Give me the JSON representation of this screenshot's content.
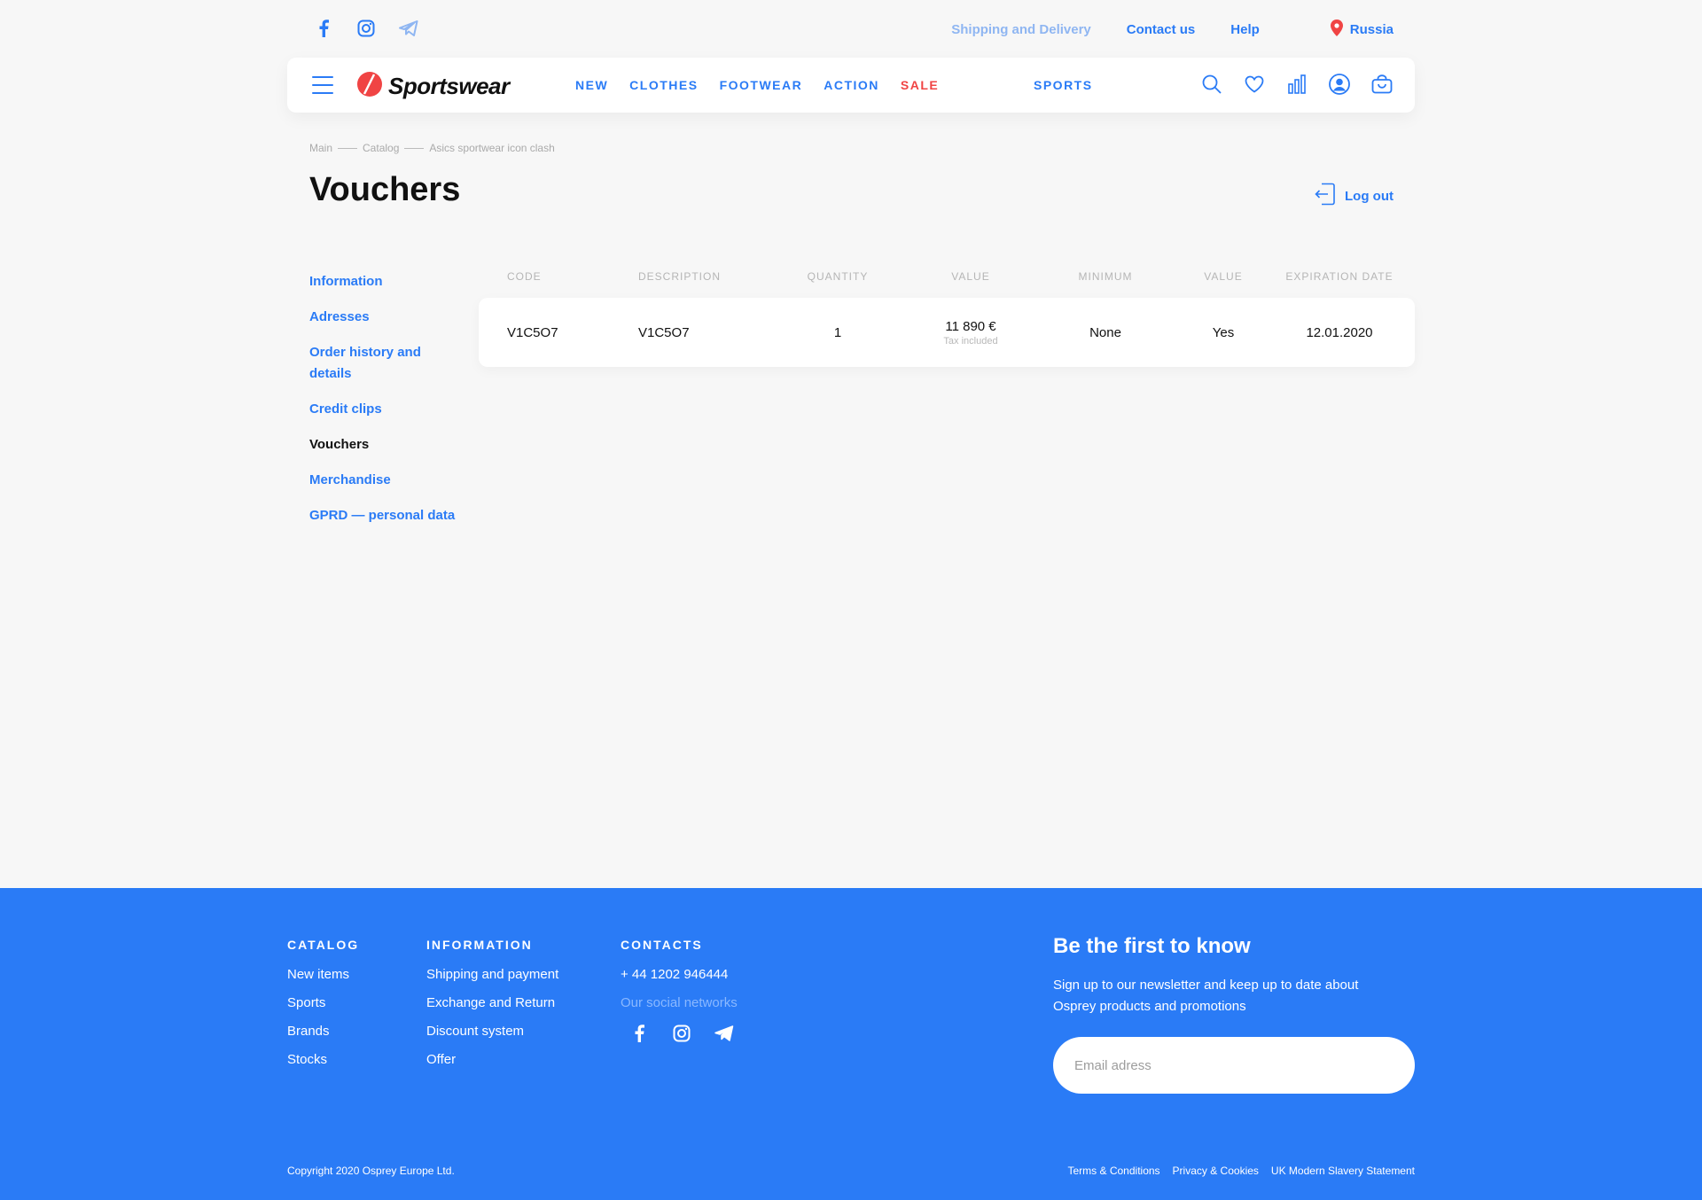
{
  "topbar": {
    "social_icons": [
      "facebook-icon",
      "instagram-icon",
      "telegram-icon"
    ],
    "links": {
      "shipping": "Shipping and Delivery",
      "contact": "Contact us",
      "help": "Help"
    },
    "region": "Russia"
  },
  "header": {
    "logo_text": "Sportswear",
    "nav": [
      "NEW",
      "CLOTHES",
      "FOOTWEAR",
      "ACTION",
      "SALE"
    ],
    "sports": "SPORTS",
    "icons": [
      "search-icon",
      "heart-icon",
      "compare-icon",
      "user-icon",
      "bag-icon"
    ]
  },
  "breadcrumb": [
    "Main",
    "Catalog",
    "Asics sportwear icon clash"
  ],
  "page": {
    "title": "Vouchers",
    "logout": "Log out"
  },
  "sidebar": {
    "items": [
      {
        "label": "Information",
        "active": false
      },
      {
        "label": "Adresses",
        "active": false
      },
      {
        "label": "Order history and details",
        "active": false
      },
      {
        "label": "Credit clips",
        "active": false
      },
      {
        "label": "Vouchers",
        "active": true
      },
      {
        "label": "Merchandise",
        "active": false
      },
      {
        "label": "GPRD — personal data",
        "active": false
      }
    ]
  },
  "table": {
    "headers": [
      "CODE",
      "DESCRIPTION",
      "QUANTITY",
      "VALUE",
      "MINIMUM",
      "VALUE",
      "EXPIRATION DATE"
    ],
    "rows": [
      {
        "code": "V1C5O7",
        "description": "V1C5O7",
        "quantity": "1",
        "value": "11 890 €",
        "value_note": "Tax included",
        "minimum": "None",
        "value2": "Yes",
        "expiration": "12.01.2020"
      }
    ]
  },
  "footer": {
    "catalog": {
      "title": "CATALOG",
      "items": [
        "New items",
        "Sports",
        "Brands",
        "Stocks"
      ]
    },
    "information": {
      "title": "INFORMATION",
      "items": [
        "Shipping and payment",
        "Exchange and Return",
        "Discount system",
        "Offer"
      ]
    },
    "contacts": {
      "title": "CONTACTS",
      "phone": "+ 44 1202 946444",
      "social_label": "Our social networks"
    },
    "newsletter": {
      "title": "Be the first to know",
      "text_line1": "Sign up to our newsletter and keep up to date about",
      "text_line2": "Osprey products and promotions",
      "placeholder": "Email adress"
    },
    "copyright": "Copyright 2020 Osprey Europe Ltd.",
    "legal": [
      "Terms & Conditions",
      "Privacy & Cookies",
      "UK Modern Slavery Statement"
    ]
  },
  "colors": {
    "accent": "#2a7bf6",
    "sale": "#f04444",
    "background": "#f7f7f7",
    "footer": "#2a7bf6"
  }
}
